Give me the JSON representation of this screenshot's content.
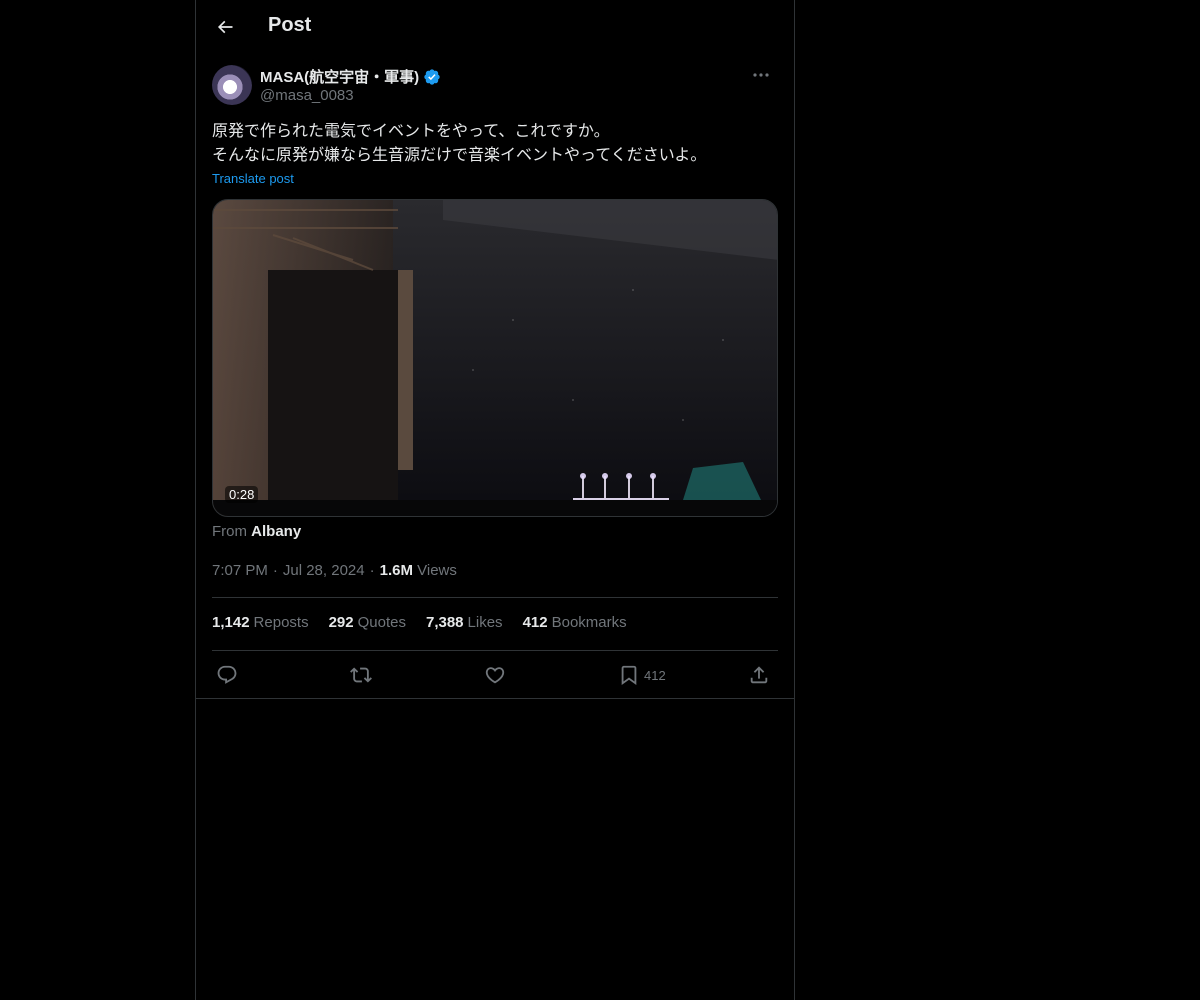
{
  "header": {
    "title": "Post"
  },
  "author": {
    "display_name": "MASA(航空宇宙・軍事)",
    "handle": "@masa_0083",
    "verified": true
  },
  "post": {
    "text": "原発で作られた電気でイベントをやって、これですか。\nそんなに原発が嫌なら生音源だけで音楽イベントやってくださいよ。",
    "translate_label": "Translate post",
    "video_duration": "0:28",
    "location_prefix": "From",
    "location": "Albany",
    "time": "7:07 PM",
    "date": "Jul 28, 2024",
    "views_count": "1.6M",
    "views_label": "Views"
  },
  "stats": {
    "reposts_count": "1,142",
    "reposts_label": "Reposts",
    "quotes_count": "292",
    "quotes_label": "Quotes",
    "likes_count": "7,388",
    "likes_label": "Likes",
    "bookmarks_count": "412",
    "bookmarks_label": "Bookmarks"
  },
  "actions": {
    "bookmark_count": "412"
  },
  "colors": {
    "accent": "#1d9bf0",
    "background": "#000000",
    "text_primary": "#e7e9ea",
    "text_secondary": "#71767b",
    "border": "#2f3336"
  }
}
